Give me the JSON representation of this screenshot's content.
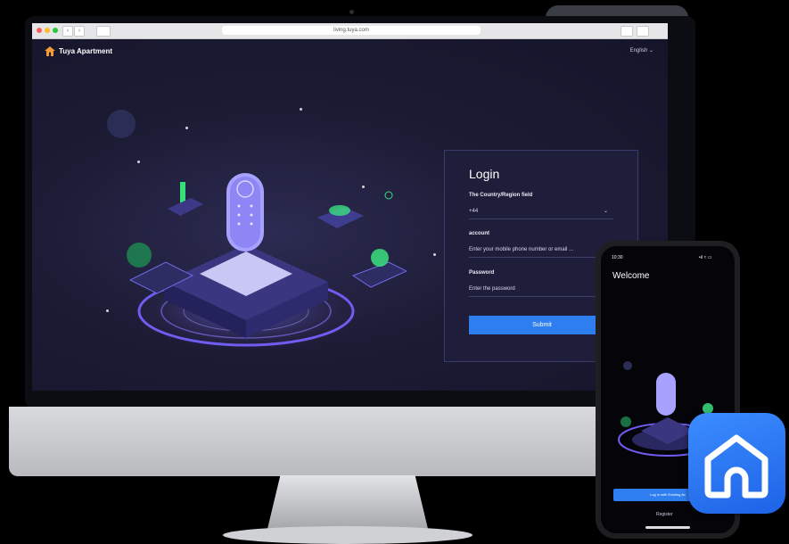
{
  "browser": {
    "url": "living.tuya.com",
    "nav_back": "‹",
    "nav_forward": "›"
  },
  "header": {
    "brand": "Tuya Apartment",
    "language": "English ⌄"
  },
  "login": {
    "title": "Login",
    "country_label": "The Country/Region field",
    "country_value": "+44",
    "account_label": "account",
    "account_placeholder": "Enter your mobile phone number or email ...",
    "password_label": "Password",
    "password_placeholder": "Enter the password",
    "submit_label": "Submit"
  },
  "phone": {
    "time": "10:30",
    "status": "•ıl ≈ ▭",
    "welcome": "Welcome",
    "login_button": "Log in with Existing Ac",
    "register": "Register"
  },
  "colors": {
    "accent": "#2f7ef0",
    "panel": "#1e1e3a",
    "page_bg": "#1a1a2e",
    "icon_blue": "#2c7cf6"
  },
  "icons": [
    "tuya-logo-icon",
    "fingerprint-icon",
    "chevron-down-icon",
    "tuya-home-app-icon"
  ]
}
